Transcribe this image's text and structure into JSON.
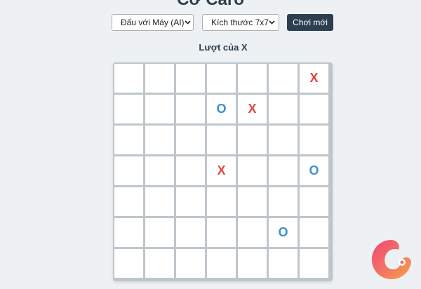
{
  "title": "Cờ Caro",
  "controls": {
    "mode_select": "Đấu với Máy (AI)",
    "size_select": "Kích thước 7x7",
    "new_game_label": "Chơi mới"
  },
  "status": {
    "turn_text": "Lượt của X"
  },
  "board": {
    "size": 7,
    "cells": [
      [
        "",
        "",
        "",
        "",
        "",
        "",
        "X"
      ],
      [
        "",
        "",
        "",
        "O",
        "X",
        "",
        ""
      ],
      [
        "",
        "",
        "",
        "",
        "",
        "",
        ""
      ],
      [
        "",
        "",
        "",
        "X",
        "",
        "",
        "O"
      ],
      [
        "",
        "",
        "",
        "",
        "",
        "",
        ""
      ],
      [
        "",
        "",
        "",
        "",
        "",
        "O",
        ""
      ],
      [
        "",
        "",
        "",
        "",
        "",
        "",
        ""
      ]
    ]
  },
  "colors": {
    "x": "#e0463b",
    "o": "#3b8fd0",
    "accent": "#2c3e50",
    "logo_gradient": [
      "#f0447a",
      "#f7a04b"
    ]
  },
  "icons": {
    "select_arrow": "chevron-down-icon",
    "logo": "brand-logo-icon"
  }
}
